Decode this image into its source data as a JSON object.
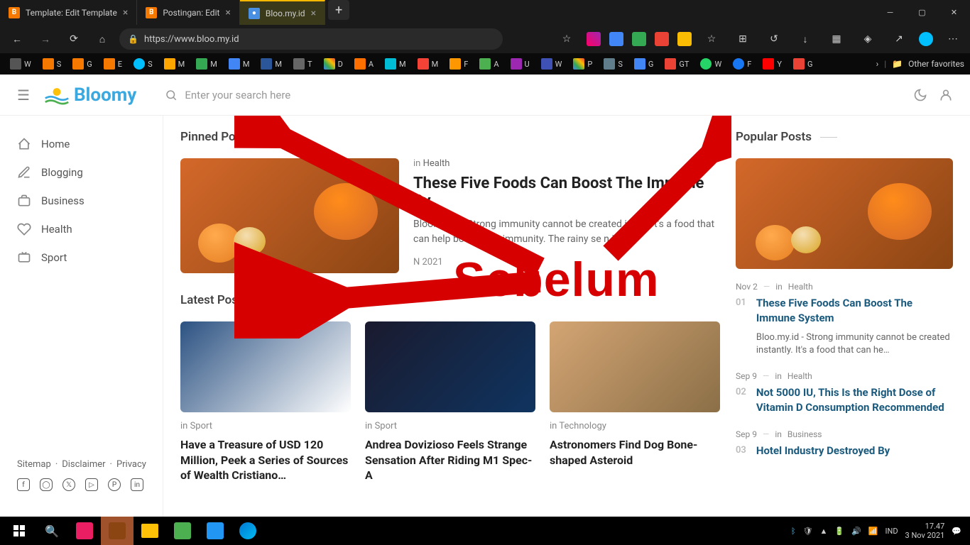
{
  "browser": {
    "tabs": [
      {
        "label": "Template: Edit Template",
        "icon": "B"
      },
      {
        "label": "Postingan: Edit",
        "icon": "B"
      },
      {
        "label": "Bloo.my.id",
        "icon": "●"
      }
    ],
    "url": "https://www.bloo.my.id",
    "otherFav": "Other favorites"
  },
  "bookmarks": [
    "W",
    "S",
    "G",
    "E",
    "S",
    "M",
    "M",
    "M",
    "M",
    "T",
    "D",
    "A",
    "M",
    "M",
    "F",
    "A",
    "U",
    "W",
    "P",
    "S",
    "G",
    "GT",
    "W",
    "F",
    "Y",
    "G"
  ],
  "site": {
    "logo": "Bloomy",
    "searchPlaceholder": "Enter your search here",
    "nav": [
      {
        "label": "Home"
      },
      {
        "label": "Blogging"
      },
      {
        "label": "Business"
      },
      {
        "label": "Health"
      },
      {
        "label": "Sport"
      }
    ],
    "footerLinks": [
      "Sitemap",
      "Disclaimer",
      "Privacy"
    ],
    "sections": {
      "pinned": "Pinned Post",
      "latest": "Latest Posts",
      "popular": "Popular Posts"
    },
    "pinned": {
      "category": "Health",
      "catPrefix": "in",
      "title": "These Five Foods Can Boost The Immune Sy",
      "excerpt": "Bloo.my.id - Strong immunity cannot be created instan         t's a food that can help boost your immunity. The rainy se       n is…",
      "date": "N       2021"
    },
    "latest": [
      {
        "catPrefix": "in",
        "category": "Sport",
        "title": "Have a Treasure of USD 120 Million, Peek a Series of Sources of Wealth Cristiano…"
      },
      {
        "catPrefix": "in",
        "category": "Sport",
        "title": "Andrea Dovizioso Feels Strange Sensation After Riding M1 Spec-A"
      },
      {
        "catPrefix": "in",
        "category": "Technology",
        "title": "Astronomers Find Dog Bone-shaped Asteroid"
      }
    ],
    "popular": [
      {
        "num": "01",
        "date": "Nov 2",
        "catPrefix": "in",
        "category": "Health",
        "title": "These Five Foods Can Boost The Immune System",
        "excerpt": "Bloo.my.id - Strong immunity cannot be created instantly. It's a food that can he…"
      },
      {
        "num": "02",
        "date": "Sep 9",
        "catPrefix": "in",
        "category": "Health",
        "title": "Not 5000 IU, This Is the Right Dose of Vitamin D Consumption Recommended"
      },
      {
        "num": "03",
        "date": "Sep 9",
        "catPrefix": "in",
        "category": "Business",
        "title": "Hotel Industry Destroyed By"
      }
    ]
  },
  "annotation": {
    "text": "Sebelum"
  },
  "taskbar": {
    "lang": "IND",
    "time": "17.47",
    "date": "3 Nov 2021"
  }
}
